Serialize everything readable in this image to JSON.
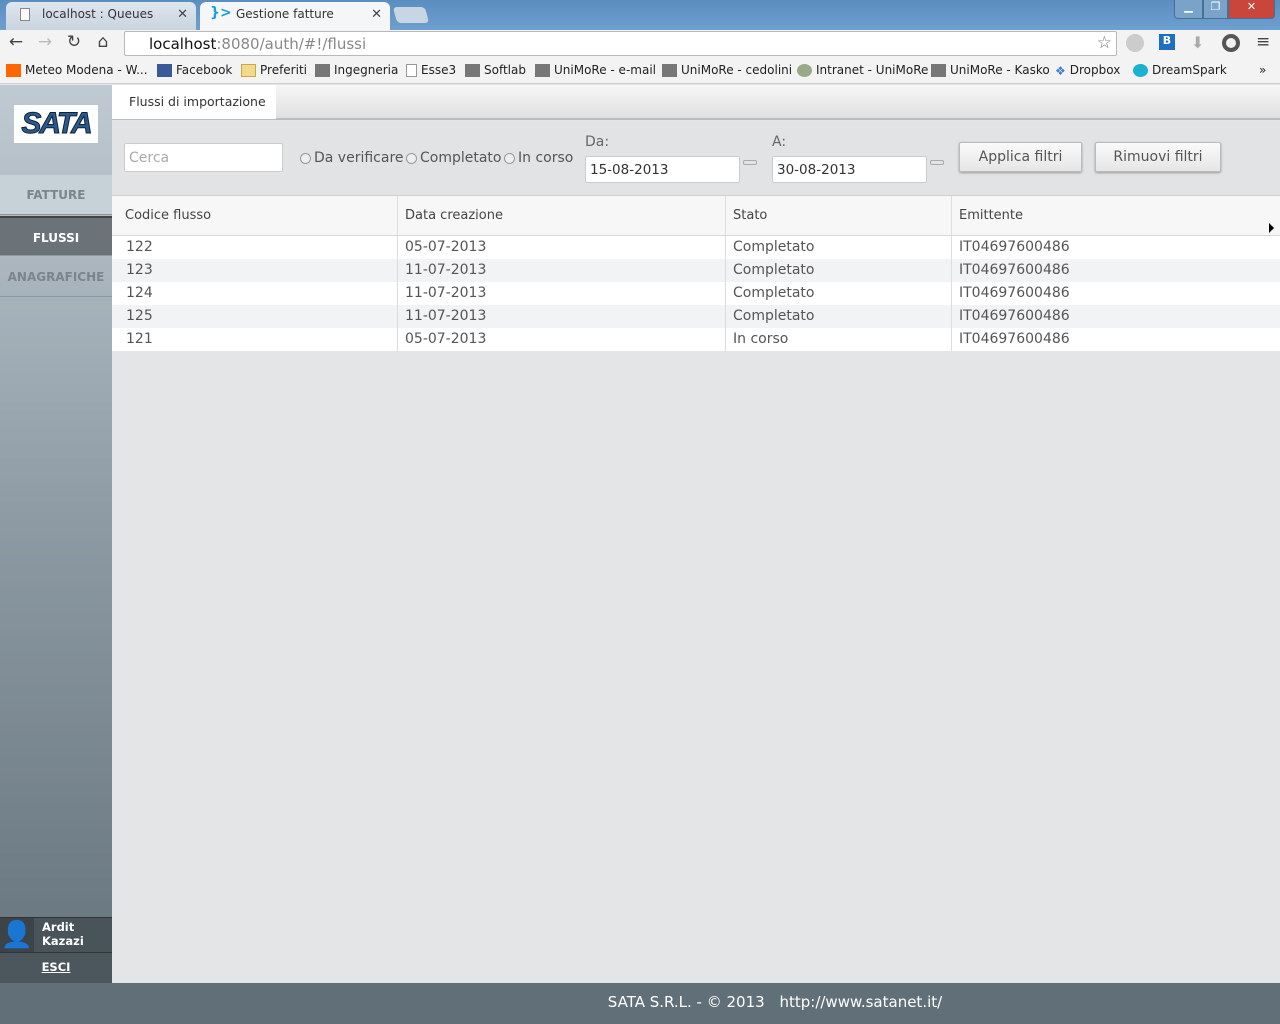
{
  "browser": {
    "tabs": [
      {
        "label": "localhost : Queues"
      },
      {
        "label": "Gestione fatture"
      }
    ],
    "url_host": "localhost",
    "url_rest": ":8080/auth/#!/flussi",
    "bookmarks": [
      "Meteo Modena - W...",
      "Facebook",
      "Preferiti",
      "Ingegneria",
      "Esse3",
      "Softlab",
      "UniMoRe - e-mail",
      "UniMoRe - cedolini",
      "Intranet - UniMoRe",
      "UniMoRe - Kasko",
      "Dropbox",
      "DreamSpark"
    ],
    "more": "»"
  },
  "sidebar": {
    "logo": "SATA",
    "items": [
      {
        "label": "FATTURE"
      },
      {
        "label": "FLUSSI",
        "active": true
      },
      {
        "label": "ANAGRAFICHE"
      }
    ],
    "user_first": "Ardit",
    "user_last": "Kazazi",
    "logout": "ESCI"
  },
  "main": {
    "tab": "Flussi di importazione",
    "filters": {
      "search_placeholder": "Cerca",
      "radios": [
        "Da verificare",
        "Completato",
        "In corso"
      ],
      "from_label": "Da:",
      "from_value": "15-08-2013",
      "to_label": "A:",
      "to_value": "30-08-2013",
      "apply": "Applica filtri",
      "remove": "Rimuovi filtri"
    },
    "table": {
      "columns": [
        "Codice flusso",
        "Data creazione",
        "Stato",
        "Emittente"
      ],
      "rows": [
        [
          "122",
          "05-07-2013",
          "Completato",
          "IT04697600486"
        ],
        [
          "123",
          "11-07-2013",
          "Completato",
          "IT04697600486"
        ],
        [
          "124",
          "11-07-2013",
          "Completato",
          "IT04697600486"
        ],
        [
          "125",
          "11-07-2013",
          "Completato",
          "IT04697600486"
        ],
        [
          "121",
          "05-07-2013",
          "In corso",
          "IT04697600486"
        ]
      ]
    }
  },
  "footer": {
    "copyright": "SATA S.R.L. - © 2013",
    "link": "http://www.satanet.it/"
  }
}
